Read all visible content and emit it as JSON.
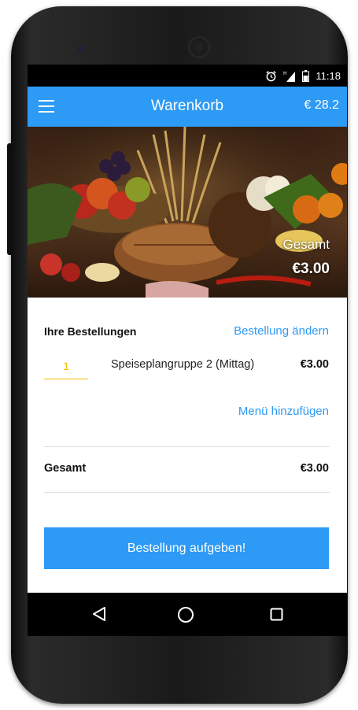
{
  "status_bar": {
    "time": "11:18",
    "alarm_icon": "alarm-clock-icon",
    "signal_icon": "signal-icon",
    "battery_icon": "battery-icon"
  },
  "app_bar": {
    "title": "Warenkorb",
    "menu_icon": "hamburger-menu-icon",
    "cart_total": "€ 28.2",
    "color": "#2d9af5"
  },
  "hero": {
    "label": "Gesamt",
    "amount": "€3.00"
  },
  "orders": {
    "title": "Ihre Bestellungen",
    "edit_label": "Bestellung ändern",
    "items": [
      {
        "quantity": "1",
        "name": "Speiseplangruppe 2 (Mittag)",
        "price": "€3.00"
      }
    ],
    "add_menu_label": "Menü hinzufügen"
  },
  "total": {
    "label": "Gesamt",
    "value": "€3.00"
  },
  "submit_label": "Bestellung aufgeben!",
  "nav_bar": {
    "back_icon": "back-triangle-icon",
    "home_icon": "home-circle-icon",
    "recents_icon": "recents-square-icon"
  },
  "colors": {
    "accent": "#2d9af5",
    "quantity_underline": "#f0c000"
  }
}
